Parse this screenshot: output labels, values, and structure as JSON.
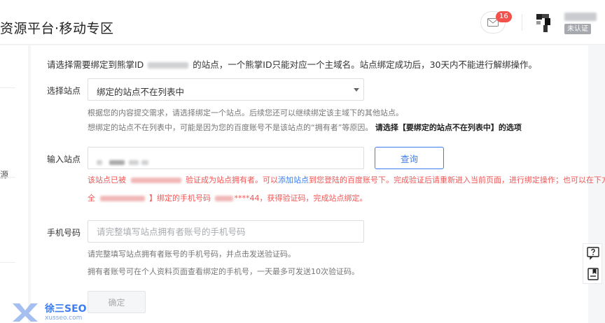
{
  "header": {
    "title": "资源平台·移动专区",
    "mail_badge": "16",
    "auth_badge": "未认证"
  },
  "sidebar": {
    "partial_char": "源"
  },
  "notice": {
    "part1": "请选择需要绑定到熊掌ID",
    "part2": "的站点，一个熊掌ID只能对应一个主域名。站点绑定成功后，30天内不能进行解绑操作。"
  },
  "select_site": {
    "label": "选择站点",
    "value": "绑定的站点不在列表中",
    "hint1": "根据您的内容提交需求，请选择绑定一个站点。后续您还可以继续绑定该主域下的其他站点。",
    "hint2": "想绑定的站点不在列表中，可能是因为您的百度账号不是该站点的“拥有者”等原因。",
    "hint2_bold": "请选择【要绑定的站点不在列表中】的选项"
  },
  "input_site": {
    "label": "输入站点",
    "query_button": "查询",
    "error_part1": "该站点已被",
    "error_part2": "验证成为站点拥有者。可以",
    "error_link": "添加站点",
    "error_part3": "到您登陆的百度账号下。完成验证后请重新进入当前页面，进行绑定操作；也可以在下方补",
    "error_line2_part1": "全",
    "error_line2_part2": "】绑定的手机号码",
    "error_line2_part3": "****44，获得验证码，完成站点绑定。"
  },
  "phone": {
    "label": "手机号码",
    "placeholder": "请完整填写站点拥有者账号的手机号码",
    "hint1": "请完整填写站点拥有者账号的手机号码，并点击发送验证码。",
    "hint2": "拥有者账号可在个人资料页面查看绑定的手机号，一天最多可发送10次验证码。"
  },
  "confirm_button": "确定",
  "watermark": {
    "text": "徐三SEO",
    "sub": "xusseo.com"
  },
  "icons": {
    "mail": "mail-icon",
    "help": "help-icon",
    "feedback": "feedback-icon"
  },
  "colors": {
    "primary": "#3d7ded",
    "error": "#f25555",
    "badge": "#f4524d"
  }
}
